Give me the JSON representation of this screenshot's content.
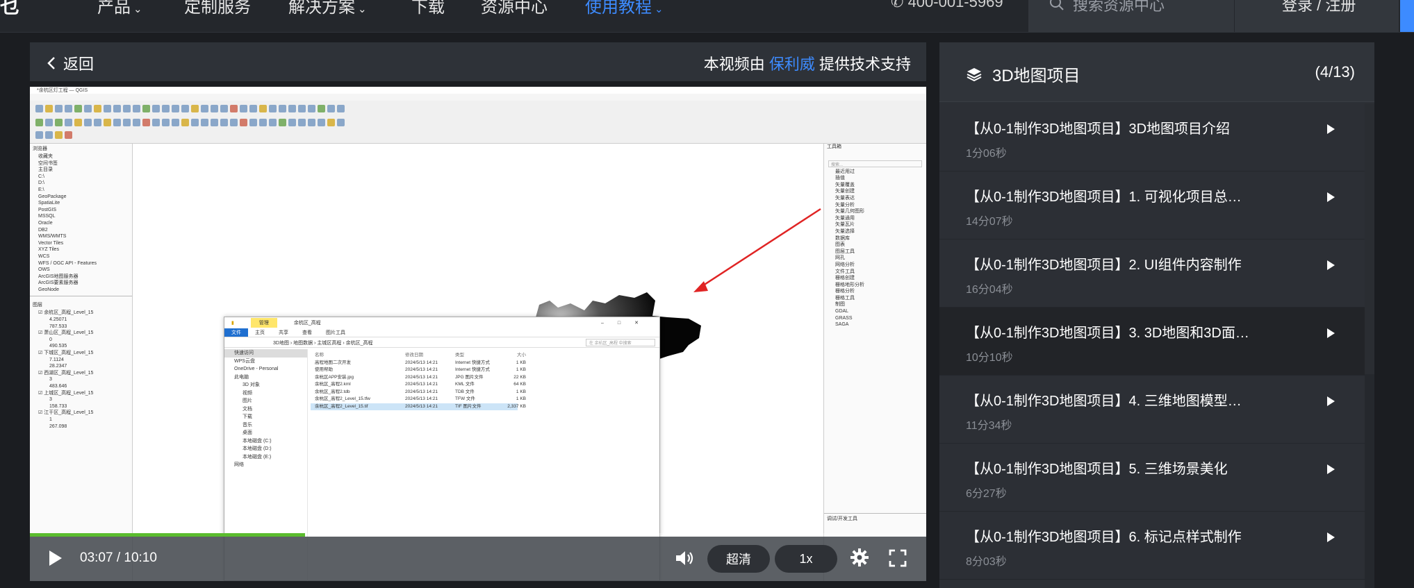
{
  "nav": {
    "logo_fragment": "乜",
    "items": [
      {
        "label": "产品",
        "has_dropdown": true,
        "active": false
      },
      {
        "label": "定制服务",
        "has_dropdown": false,
        "active": false
      },
      {
        "label": "解决方案",
        "has_dropdown": true,
        "active": false
      },
      {
        "label": "下载",
        "has_dropdown": false,
        "active": false
      },
      {
        "label": "资源中心",
        "has_dropdown": false,
        "active": false
      },
      {
        "label": "使用教程",
        "has_dropdown": true,
        "active": true
      }
    ],
    "phone": "400-001-5969",
    "search_placeholder": "搜索资源中心",
    "login_label": "登录 / 注册"
  },
  "player": {
    "back_label": "返回",
    "support_prefix": "本视频由",
    "support_link": "保利威",
    "support_suffix": "提供技术支持",
    "current_time": "03:07",
    "duration": "10:10",
    "time_separator": " / ",
    "progress_fraction": 0.307,
    "quality_label": "超清",
    "speed_label": "1x",
    "colors": {
      "progress": "#5bbc2e",
      "link": "#3d8bff"
    }
  },
  "video_frame": {
    "qgis_title": "*余杭区灯工程 — QGIS",
    "browser_items": [
      "收藏夹",
      "空间书签",
      "主目录",
      "C:\\",
      "D:\\",
      "E:\\",
      "GeoPackage",
      "SpatiaLite",
      "PostGIS",
      "MSSQL",
      "Oracle",
      "DB2",
      "WMS/WMTS",
      "Vector Tiles",
      "XYZ Tiles",
      "WCS",
      "WFS / OGC API - Features",
      "OWS",
      "ArcGIS地图服务器",
      "ArcGIS要素服务器",
      "GeoNode"
    ],
    "layers": [
      {
        "name": "余杭区_高程_Level_15",
        "max": "4.25071",
        "min": "787.533"
      },
      {
        "name": "萧山区_高程_Level_15",
        "max": "0",
        "min": "490.535"
      },
      {
        "name": "下城区_高程_Level_15",
        "max": "7.1124",
        "min": "28.2347"
      },
      {
        "name": "西湖区_高程_Level_15",
        "max": "3",
        "min": "483.646"
      },
      {
        "name": "上城区_高程_Level_15",
        "max": "3",
        "min": "158.733"
      },
      {
        "name": "江干区_高程_Level_15",
        "max": "1",
        "min": "267.098"
      }
    ],
    "toolbox_items": [
      "最近用过",
      "插值",
      "矢量覆盖",
      "矢量创建",
      "矢量表达",
      "矢量分析",
      "矢量几何图形",
      "矢量通用",
      "矢量瓦片",
      "矢量选择",
      "数据库",
      "图表",
      "图层工具",
      "网孔",
      "网络分析",
      "文件工具",
      "栅格创建",
      "栅格地形分析",
      "栅格分析",
      "栅格工具",
      "制图",
      "GDAL",
      "GRASS",
      "SAGA"
    ],
    "explorer": {
      "tab_manage": "管理",
      "path_title": "余杭区_高程",
      "ribbon": [
        "文件",
        "主页",
        "共享",
        "查看",
        "图片工具"
      ],
      "address": "3D地图 › 地图数据 › 主城区高程 › 余杭区_高程",
      "search_placeholder": "在 余杭区_高程 中搜索",
      "nav": [
        "快速访问",
        "WPS云盘",
        "OneDrive - Personal",
        "此电脑",
        "3D 对象",
        "视频",
        "图片",
        "文档",
        "下载",
        "音乐",
        "桌面",
        "本地磁盘 (C:)",
        "本地磁盘 (D:)",
        "本地磁盘 (E:)",
        "网络"
      ],
      "columns": [
        "名称",
        "修改日期",
        "类型",
        "大小"
      ],
      "files": [
        {
          "name": "高程地图二次开发",
          "date": "2024/5/13 14:21",
          "type": "Internet 快捷方式",
          "size": "1 KB"
        },
        {
          "name": "使用帮助",
          "date": "2024/5/13 14:21",
          "type": "Internet 快捷方式",
          "size": "1 KB"
        },
        {
          "name": "余杭区APP安装.jpg",
          "date": "2024/5/13 14:21",
          "type": "JPG 图片文件",
          "size": "22 KB"
        },
        {
          "name": "余杭区_高程2.kml",
          "date": "2024/5/13 14:21",
          "type": "KML 文件",
          "size": "64 KB"
        },
        {
          "name": "余杭区_高程2.tdb",
          "date": "2024/5/13 14:21",
          "type": "TDB 文件",
          "size": "1 KB"
        },
        {
          "name": "余杭区_高程2_Level_15.tfw",
          "date": "2024/5/13 14:21",
          "type": "TFW 文件",
          "size": "1 KB"
        },
        {
          "name": "余杭区_高程2_Level_15.tif",
          "date": "2024/5/13 14:21",
          "type": "TIF 图片文件",
          "size": "2,337 KB"
        }
      ]
    }
  },
  "playlist": {
    "title": "3D地图项目",
    "count": "(4/13)",
    "items": [
      {
        "title": "【从0-1制作3D地图项目】3D地图项目介绍",
        "duration": "1分06秒",
        "active": false
      },
      {
        "title": "【从0-1制作3D地图项目】1. 可视化项目总…",
        "duration": "14分07秒",
        "active": false
      },
      {
        "title": "【从0-1制作3D地图项目】2. UI组件内容制作",
        "duration": "16分04秒",
        "active": false
      },
      {
        "title": "【从0-1制作3D地图项目】3. 3D地图和3D面…",
        "duration": "10分10秒",
        "active": true
      },
      {
        "title": "【从0-1制作3D地图项目】4. 三维地图模型…",
        "duration": "11分34秒",
        "active": false
      },
      {
        "title": "【从0-1制作3D地图项目】5. 三维场景美化",
        "duration": "6分27秒",
        "active": false
      },
      {
        "title": "【从0-1制作3D地图项目】6. 标记点样式制作",
        "duration": "8分03秒",
        "active": false
      }
    ]
  }
}
